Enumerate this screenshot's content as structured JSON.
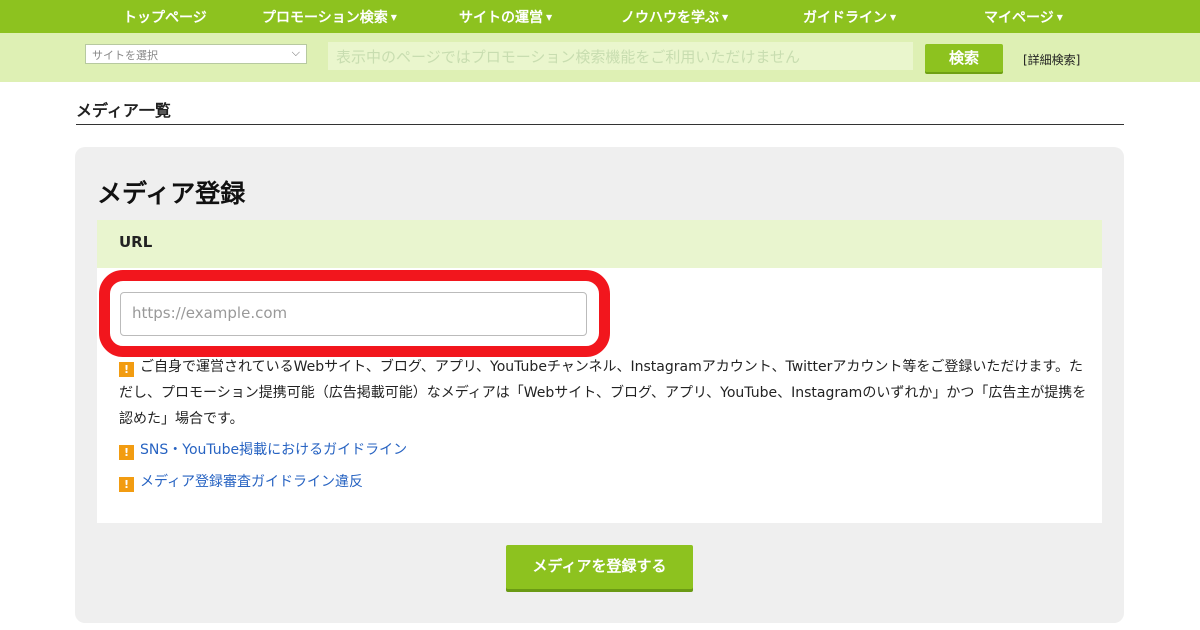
{
  "nav": {
    "items": [
      {
        "label": "トップページ",
        "caret": ""
      },
      {
        "label": "プロモーション検索",
        "caret": "▼"
      },
      {
        "label": "サイトの運営",
        "caret": "▼"
      },
      {
        "label": "ノウハウを学ぶ",
        "caret": "▼"
      },
      {
        "label": "ガイドライン",
        "caret": "▼"
      },
      {
        "label": "マイページ",
        "caret": "▼"
      }
    ]
  },
  "search": {
    "site_select_value": "サイトを選択",
    "placeholder": "表示中のページではプロモーション検索機能をご利用いただけません",
    "button_label": "検索",
    "advanced_link": "[詳細検索]"
  },
  "page": {
    "title": "メディア一覧"
  },
  "form": {
    "title": "メディア登録",
    "url_label": "URL",
    "url_placeholder": "https://example.com",
    "note": "ご自身で運営されているWebサイト、ブログ、アプリ、YouTubeチャンネル、Instagramアカウント、Twitterアカウント等をご登録いただけます。ただし、プロモーション提携可能（広告掲載可能）なメディアは「Webサイト、ブログ、アプリ、YouTube、Instagramのいずれか」かつ「広告主が提携を認めた」場合です。",
    "links": [
      "SNS・YouTube掲載におけるガイドライン",
      "メディア登録審査ガイドライン違反"
    ],
    "warn_icon": "!",
    "submit_label": "メディアを登録する"
  },
  "colors": {
    "brand_green": "#8dc21f",
    "highlight_red": "#f2161d",
    "warning_orange": "#f29c11",
    "link_blue": "#2763c2"
  }
}
